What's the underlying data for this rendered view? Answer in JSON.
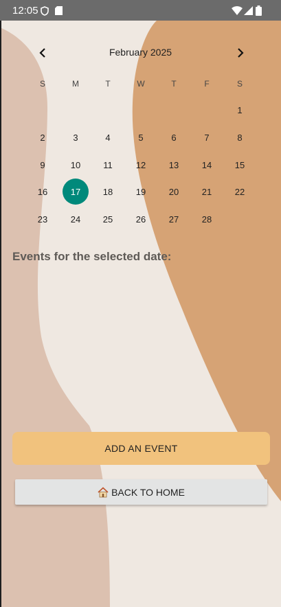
{
  "status_bar": {
    "time": "12:05"
  },
  "calendar": {
    "month_title": "February 2025",
    "weekdays": [
      "S",
      "M",
      "T",
      "W",
      "T",
      "F",
      "S"
    ],
    "selected_day": 17,
    "weeks": [
      [
        "",
        "",
        "",
        "",
        "",
        "",
        "1"
      ],
      [
        "2",
        "3",
        "4",
        "5",
        "6",
        "7",
        "8"
      ],
      [
        "9",
        "10",
        "11",
        "12",
        "13",
        "14",
        "15"
      ],
      [
        "16",
        "17",
        "18",
        "19",
        "20",
        "21",
        "22"
      ],
      [
        "23",
        "24",
        "25",
        "26",
        "27",
        "28",
        ""
      ]
    ]
  },
  "events": {
    "heading": "Events for the selected date:"
  },
  "actions": {
    "add_event_label": "ADD AN EVENT",
    "back_home_label": "BACK TO HOME"
  },
  "colors": {
    "background": "#efe8e1",
    "selected_day": "#00897b",
    "add_button": "#f1c27d",
    "left_blob": "#dcc1b0",
    "right_blob": "#d6a375"
  }
}
